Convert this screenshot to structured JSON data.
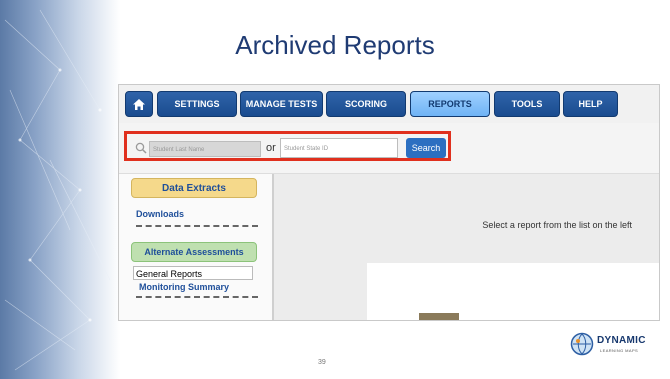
{
  "slide": {
    "title": "Archived Reports",
    "page_number": "39"
  },
  "nav": {
    "home_icon": "home-icon",
    "items": [
      {
        "label": "SETTINGS"
      },
      {
        "label": "MANAGE TESTS"
      },
      {
        "label": "SCORING"
      },
      {
        "label": "REPORTS",
        "active": true
      },
      {
        "label": "TOOLS"
      },
      {
        "label": "HELP"
      }
    ]
  },
  "search": {
    "last_name_placeholder": "Student Last Name",
    "or_label": "or",
    "state_id_placeholder": "Student State ID",
    "button_label": "Search"
  },
  "sidebar": {
    "data_extracts": "Data Extracts",
    "downloads": "Downloads",
    "alternate_assessments": "Alternate Assessments",
    "general_reports": "General Reports",
    "monitoring_summary": "Monitoring Summary"
  },
  "main": {
    "message": "Select a report from the list on the left"
  },
  "logo": {
    "name": "DYNAMIC",
    "tagline": "LEARNING MAPS"
  },
  "colors": {
    "title": "#1f3b73",
    "nav_button": "#1a4c8f",
    "nav_active": "#9fd0ff",
    "highlight": "#e0301e",
    "extract_button": "#f5d98b",
    "alt_button": "#bfe0b0"
  }
}
